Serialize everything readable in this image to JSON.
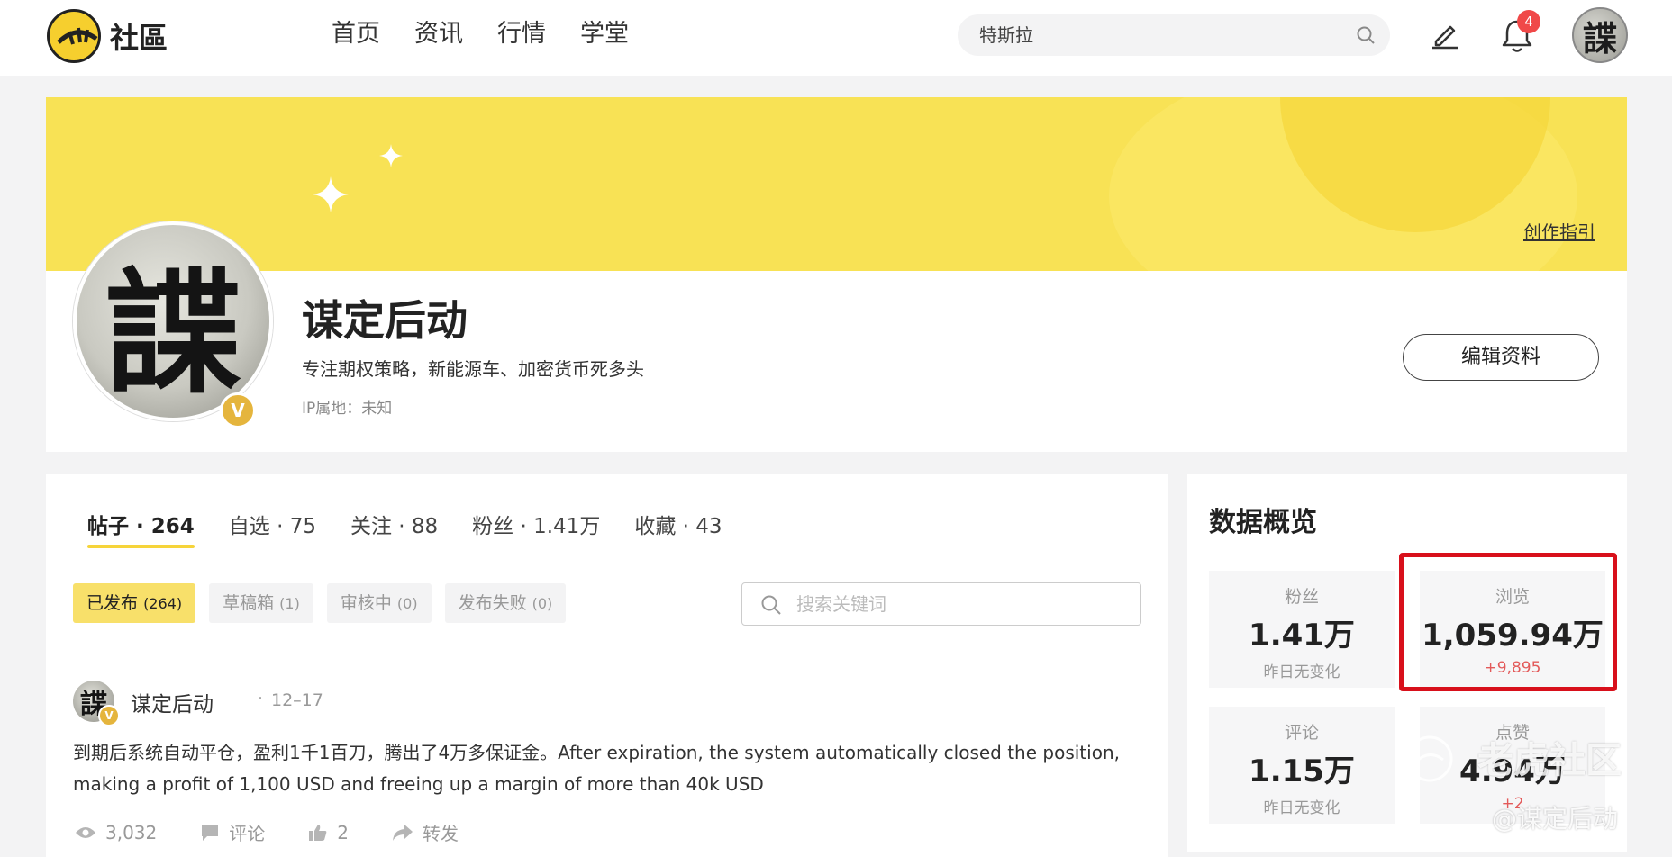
{
  "topnav": {
    "logo_text": "社區",
    "links": [
      "首页",
      "资讯",
      "行情",
      "学堂"
    ],
    "search_placeholder": "特斯拉",
    "notification_count": "4",
    "avatar_glyph": "諜"
  },
  "profile": {
    "guide_link": "创作指引",
    "avatar_glyph": "諜",
    "verified_badge": "V",
    "name": "谋定后动",
    "bio": "专注期权策略，新能源车、加密货币死多头",
    "ip": "IP属地：未知",
    "edit_button": "编辑资料"
  },
  "tabs": [
    {
      "label": "帖子 · 264"
    },
    {
      "label": "自选 · 75"
    },
    {
      "label": "关注 · 88"
    },
    {
      "label": "粉丝 · 1.41万"
    },
    {
      "label": "收藏 · 43"
    }
  ],
  "filters": [
    {
      "label": "已发布",
      "count": "(264)"
    },
    {
      "label": "草稿箱",
      "count": "(1)"
    },
    {
      "label": "审核中",
      "count": "(0)"
    },
    {
      "label": "发布失败",
      "count": "(0)"
    }
  ],
  "post_search_placeholder": "搜索关键词",
  "post": {
    "avatar_glyph": "諜",
    "verified_badge": "V",
    "author": "谋定后动",
    "separator": "·",
    "date": "12–17",
    "body": "到期后系统自动平仓，盈利1千1百刀，腾出了4万多保证金。After expiration, the system automatically closed the position, making a profit of 1,100 USD and freeing up a margin of more than 40k USD",
    "views": "3,032",
    "comment_label": "评论",
    "likes": "2",
    "share_label": "转发"
  },
  "overview": {
    "title": "数据概览",
    "stats": [
      {
        "label": "粉丝",
        "value": "1.41万",
        "sub": "昨日无变化"
      },
      {
        "label": "浏览",
        "value": "1,059.94万",
        "sub": "+9,895"
      },
      {
        "label": "评论",
        "value": "1.15万",
        "sub": "昨日无变化"
      },
      {
        "label": "点赞",
        "value": "4.94万",
        "sub": "+2"
      }
    ]
  },
  "watermark": {
    "main": "老虎社区",
    "sub": "@谋定后动"
  },
  "colors": {
    "accent_yellow": "#f6d43a",
    "banner_yellow": "#f8e255",
    "highlight_red": "#d8101b",
    "increase_red": "#e35a5a",
    "badge_red": "#f04848"
  }
}
